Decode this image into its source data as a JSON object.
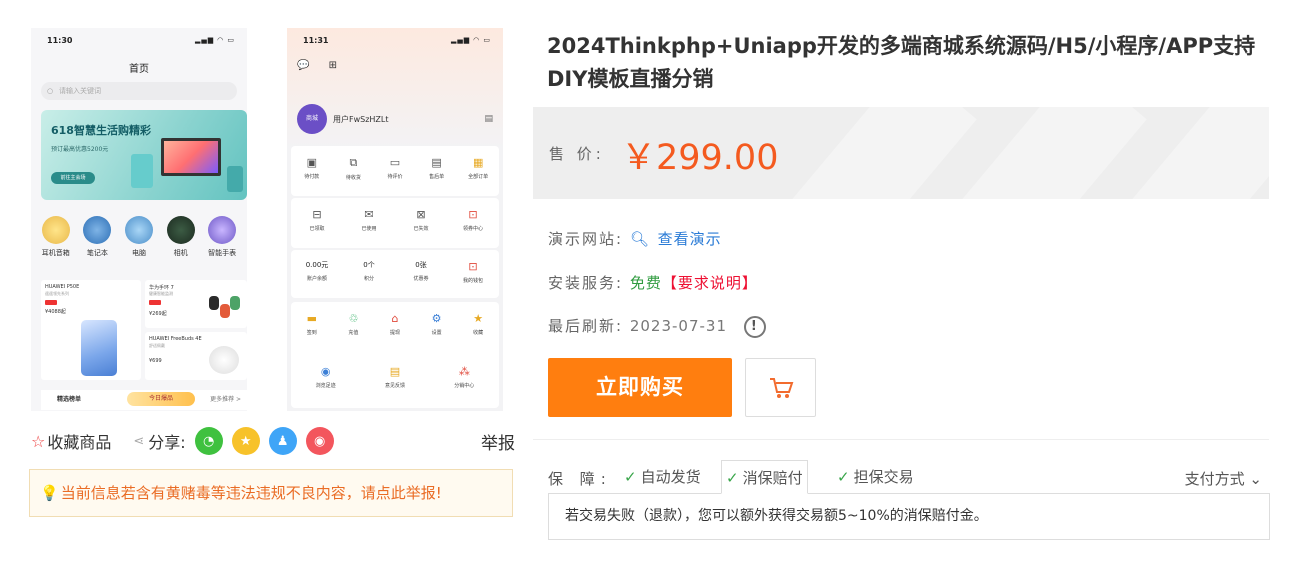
{
  "phone1": {
    "time": "11:30",
    "signal": "▂▄▆ ◠ ▭",
    "title": "首页",
    "search_placeholder": "请输入关键词",
    "banner": {
      "title": "618智慧生活购精彩",
      "subtitle": "预订最高优惠5200元",
      "button": "前往主会场"
    },
    "categories": [
      "耳机音箱",
      "笔记本",
      "电脑",
      "相机",
      "智能手表"
    ],
    "products": [
      {
        "name": "HUAWEI P50E",
        "sub": "遥遥领先系列",
        "price": "¥4088起"
      },
      {
        "name": "华为手环 7",
        "sub": "健康智能监测",
        "price": "¥269起"
      },
      {
        "name": "HUAWEI FreeBuds 4E",
        "sub": "舒适佩戴",
        "price": "¥699"
      }
    ],
    "bottom": {
      "left": "精选榜单",
      "center": "今日爆品",
      "right": "更多推荐 >"
    }
  },
  "phone2": {
    "time": "11:31",
    "signal": "▂▄▆ ◠ ▭",
    "header_icons": "💬 ⊞",
    "avatar_text": "商城",
    "username": "用户FwSzHZLt",
    "scan_icon": "▤",
    "orders": [
      {
        "glyph": "▣",
        "label": "待付款"
      },
      {
        "glyph": "⧉",
        "label": "待收货"
      },
      {
        "glyph": "▭",
        "label": "待评价"
      },
      {
        "glyph": "▤",
        "label": "售后单"
      },
      {
        "glyph": "▦",
        "label": "全部订单"
      }
    ],
    "coupons": [
      {
        "glyph": "⊟",
        "label": "已领取"
      },
      {
        "glyph": "✉",
        "label": "已使用"
      },
      {
        "glyph": "⊠",
        "label": "已失效"
      },
      {
        "glyph": "⊡",
        "label": "领券中心"
      }
    ],
    "assets": [
      {
        "num": "0.00元",
        "label": "账户余额"
      },
      {
        "num": "0个",
        "label": "积分"
      },
      {
        "num": "0张",
        "label": "优惠券"
      },
      {
        "glyph": "⊡",
        "label": "我的钱包"
      }
    ],
    "services": [
      {
        "glyph": "▬",
        "label": "签到"
      },
      {
        "glyph": "♲",
        "label": "充值"
      },
      {
        "glyph": "⌂",
        "label": "提现"
      },
      {
        "glyph": "⚙",
        "label": "设置"
      },
      {
        "glyph": "★",
        "label": "收藏"
      },
      {
        "glyph": "◉",
        "label": "浏览足迹"
      },
      {
        "glyph": "▤",
        "label": "意见反馈"
      },
      {
        "glyph": "⁂",
        "label": "分销中心"
      }
    ]
  },
  "actions": {
    "favorite": "收藏商品",
    "share": "分享:",
    "report": "举报",
    "share_icons": [
      "wechat-icon",
      "qzone-icon",
      "qq-icon",
      "weibo-icon"
    ]
  },
  "warning": "当前信息若含有黄赌毒等违法违规不良内容，请点此举报!",
  "product": {
    "title": "2024Thinkphp+Uniapp开发的多端商城系统源码/H5/小程序/APP支持DIY模板直播分销",
    "price_label": "售 价:",
    "price": "￥299.00",
    "demo_label": "演示网站:",
    "demo_link": "查看演示",
    "install_label": "安装服务:",
    "install_value": "免费",
    "install_note": "【要求说明】",
    "refresh_label": "最后刷新:",
    "refresh_date": "2023-07-31",
    "buy_button": "立即购买"
  },
  "guarantee": {
    "label": "保 障:",
    "items": [
      "自动发货",
      "消保赔付",
      "担保交易"
    ],
    "payment": "支付方式",
    "detail": "若交易失败（退款），您可以额外获得交易额5~10%的消保赔付金。"
  },
  "colors": {
    "price": "#f45a1f",
    "buy": "#ff7e0f",
    "link": "#2a7bd6",
    "free": "#2f9b3f",
    "check": "#3aa64b"
  }
}
